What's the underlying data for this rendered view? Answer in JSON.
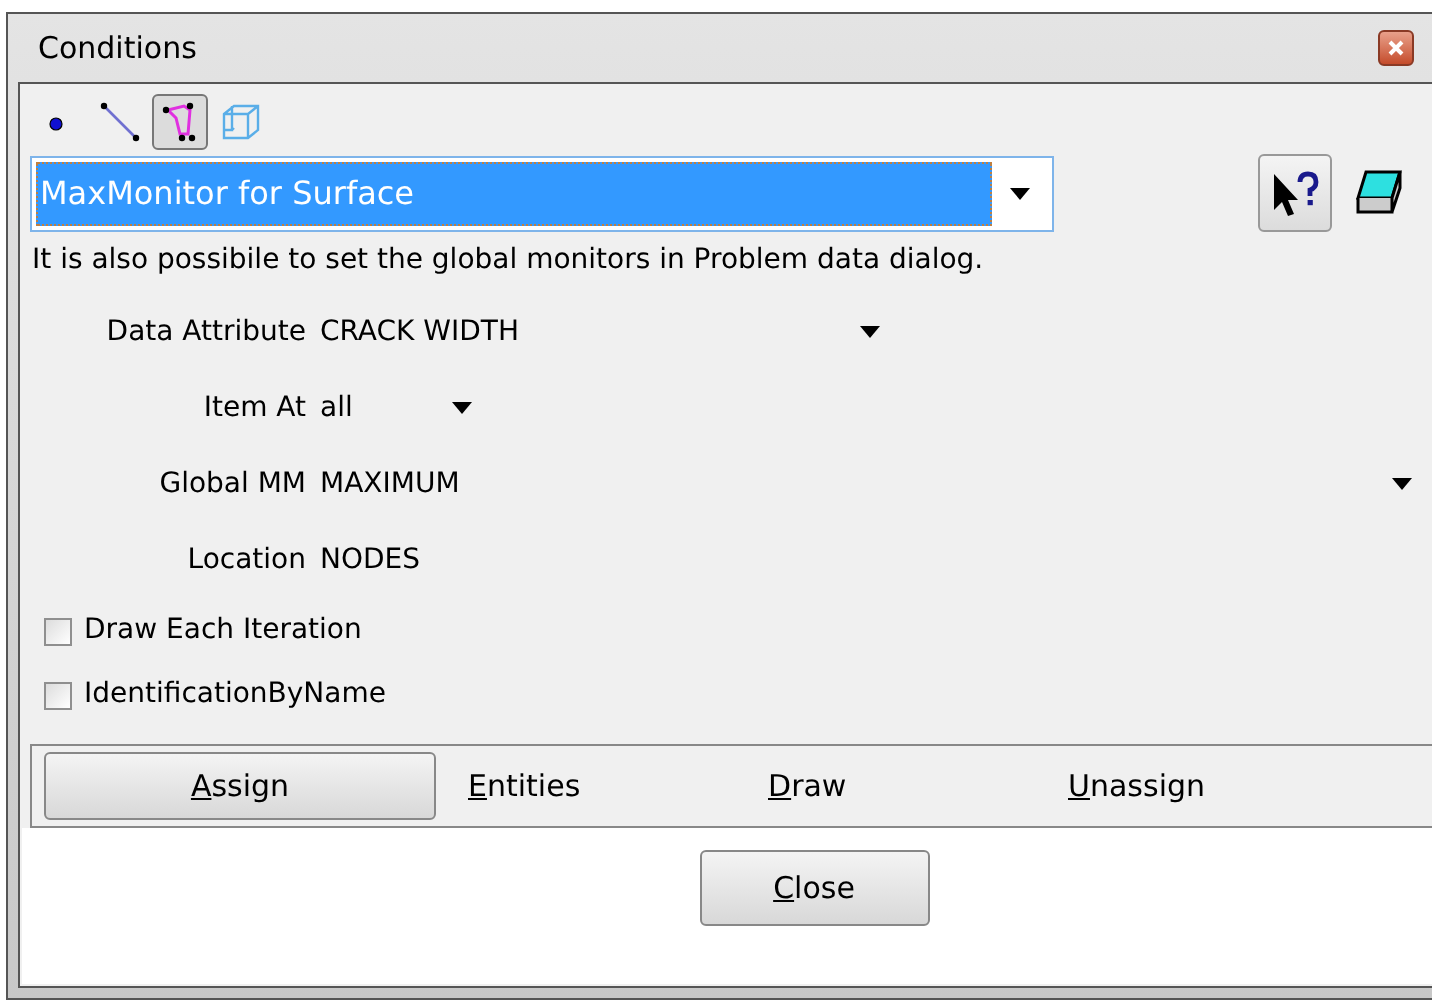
{
  "window": {
    "title": "Conditions"
  },
  "tools": [
    {
      "kind": "point",
      "selected": false
    },
    {
      "kind": "line",
      "selected": false
    },
    {
      "kind": "surface",
      "selected": true
    },
    {
      "kind": "volume",
      "selected": false
    }
  ],
  "condition": {
    "value": "MaxMonitor for Surface"
  },
  "note": "It is also possibile to set the global monitors in Problem data dialog.",
  "fields": [
    {
      "kind": "dropdown",
      "label": "Data Attribute",
      "value": "CRACK WIDTH"
    },
    {
      "kind": "dropdown",
      "label": "Item At",
      "value": "all"
    },
    {
      "kind": "dropdown",
      "label": "Global MM",
      "value": "MAXIMUM"
    },
    {
      "kind": "static",
      "label": "Location",
      "value": "NODES"
    }
  ],
  "checkboxes": [
    {
      "label": "Draw Each Iteration",
      "checked": false
    },
    {
      "label": "IdentificationByName",
      "checked": false
    }
  ],
  "actions": [
    {
      "label": "Assign",
      "selected": true
    },
    {
      "label": "Entities",
      "selected": false
    },
    {
      "label": "Draw",
      "selected": false
    },
    {
      "label": "Unassign",
      "selected": false
    }
  ],
  "close": "Close"
}
